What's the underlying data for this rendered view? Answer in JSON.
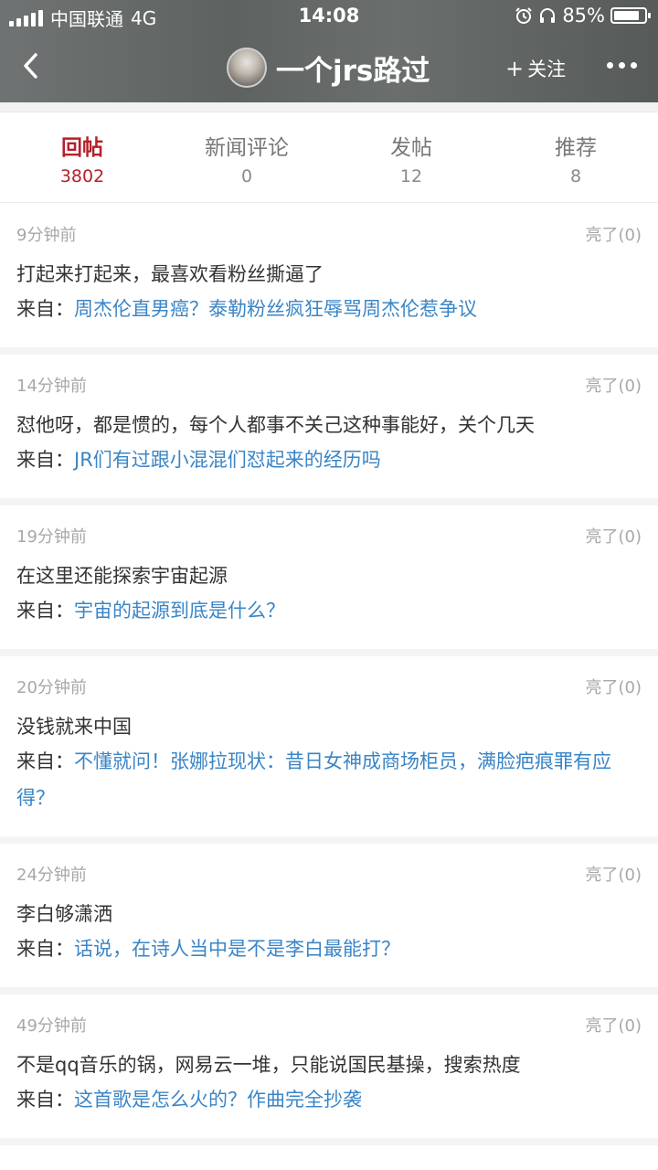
{
  "status_bar": {
    "carrier": "中国联通",
    "network": "4G",
    "time": "14:08",
    "battery": "85%",
    "battery_level": 0.85
  },
  "nav": {
    "title": "一个jrs路过",
    "follow_label": "关注",
    "follow_plus": "+"
  },
  "tabs": [
    {
      "label": "回帖",
      "count": "3802",
      "active": true
    },
    {
      "label": "新闻评论",
      "count": "0",
      "active": false
    },
    {
      "label": "发帖",
      "count": "12",
      "active": false
    },
    {
      "label": "推荐",
      "count": "8",
      "active": false
    }
  ],
  "from_prefix": "来自：",
  "posts": [
    {
      "time": "9分钟前",
      "light": "亮了(0)",
      "content": "打起来打起来，最喜欢看粉丝撕逼了",
      "source": "周杰伦直男癌？泰勒粉丝疯狂辱骂周杰伦惹争议"
    },
    {
      "time": "14分钟前",
      "light": "亮了(0)",
      "content": "怼他呀，都是惯的，每个人都事不关己这种事能好，关个几天",
      "source": "JR们有过跟小混混们怼起来的经历吗"
    },
    {
      "time": "19分钟前",
      "light": "亮了(0)",
      "content": "在这里还能探索宇宙起源",
      "source": "宇宙的起源到底是什么？"
    },
    {
      "time": "20分钟前",
      "light": "亮了(0)",
      "content": "没钱就来中国",
      "source": "不懂就问！张娜拉现状：昔日女神成商场柜员，满脸疤痕罪有应得？"
    },
    {
      "time": "24分钟前",
      "light": "亮了(0)",
      "content": "李白够潇洒",
      "source": "话说，在诗人当中是不是李白最能打？"
    },
    {
      "time": "49分钟前",
      "light": "亮了(0)",
      "content": "不是qq音乐的锅，网易云一堆，只能说国民基操，搜索热度",
      "source": "这首歌是怎么火的？作曲完全抄袭"
    }
  ]
}
